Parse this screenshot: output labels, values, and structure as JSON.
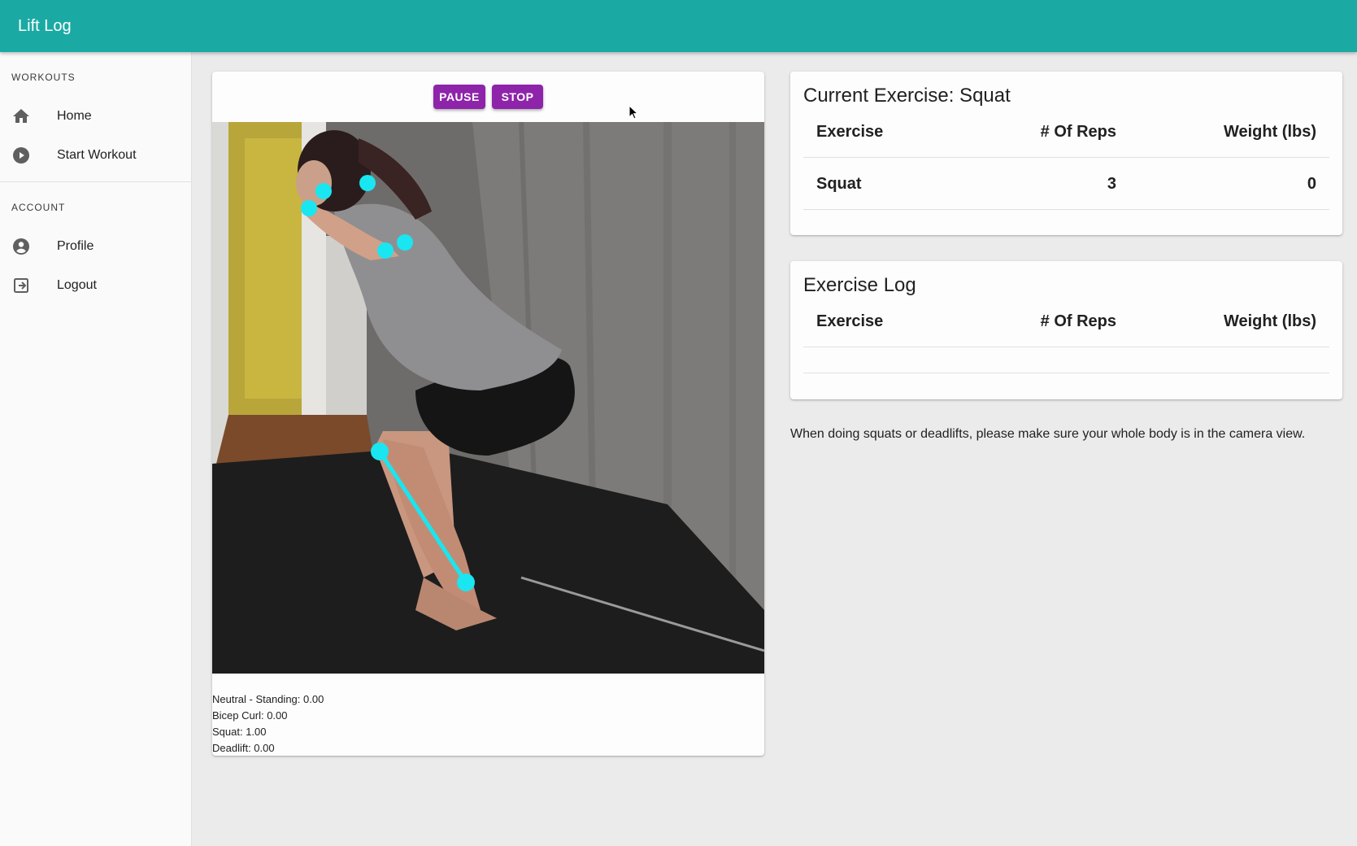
{
  "app": {
    "title": "Lift Log"
  },
  "sidebar": {
    "workouts_header": "WORKOUTS",
    "account_header": "ACCOUNT",
    "items": [
      {
        "label": "Home",
        "icon": "home-icon"
      },
      {
        "label": "Start Workout",
        "icon": "play-circle-icon"
      },
      {
        "label": "Profile",
        "icon": "account-circle-icon"
      },
      {
        "label": "Logout",
        "icon": "logout-icon"
      }
    ]
  },
  "controls": {
    "pause_label": "PAUSE",
    "stop_label": "STOP",
    "accent": "#8e24aa"
  },
  "predictions": [
    "Neutral - Standing: 0.00",
    "Bicep Curl: 0.00",
    "Squat: 1.00",
    "Deadlift: 0.00"
  ],
  "current_exercise": {
    "title": "Current Exercise: Squat",
    "headers": [
      "Exercise",
      "# Of Reps",
      "Weight (lbs)"
    ],
    "rows": [
      {
        "exercise": "Squat",
        "reps": "3",
        "weight": "0"
      }
    ]
  },
  "exercise_log": {
    "title": "Exercise Log",
    "headers": [
      "Exercise",
      "# Of Reps",
      "Weight (lbs)"
    ],
    "rows": []
  },
  "tip": "When doing squats or deadlifts, please make sure your whole body is in the camera view.",
  "colors": {
    "appbar": "#1aaaa3",
    "keypoint": "#19e6f0"
  }
}
